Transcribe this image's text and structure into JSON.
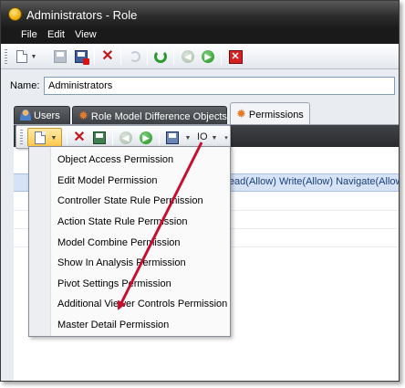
{
  "window": {
    "title": "Administrators - Role"
  },
  "menu": {
    "items": [
      "File",
      "Edit",
      "View"
    ]
  },
  "toolbar": {
    "icons": [
      "new-icon",
      "dropdown-arrow-icon",
      "save-icon",
      "save-and-close-icon",
      "delete-icon",
      "undo-icon",
      "refresh-icon",
      "previous-icon",
      "next-icon",
      "close-icon"
    ]
  },
  "name": {
    "label": "Name:",
    "value": "Administrators"
  },
  "tabs": [
    {
      "label": "Users",
      "icon": "users-icon",
      "active": false
    },
    {
      "label": "Role Model Difference Objects",
      "icon": "gear-icon",
      "active": false
    },
    {
      "label": "Permissions",
      "icon": "gear-icon",
      "active": true
    }
  ],
  "subtoolbar": {
    "io_label": "IO"
  },
  "grid": {
    "selected_row_text": "Read(Allow) Write(Allow) Navigate(Allow);"
  },
  "dropdown": {
    "items": [
      "Object Access Permission",
      "Edit Model Permission",
      "Controller State Rule Permission",
      "Action State Rule Permission",
      "Model Combine Permission",
      "Show In Analysis Permission",
      "Pivot Settings Permission",
      "Additional Viewer Controls Permission",
      "Master Detail Permission"
    ]
  },
  "colors": {
    "arrow": "#c8102e",
    "selection": "#d6e3f7",
    "titlebar": "#2e2e2e"
  }
}
